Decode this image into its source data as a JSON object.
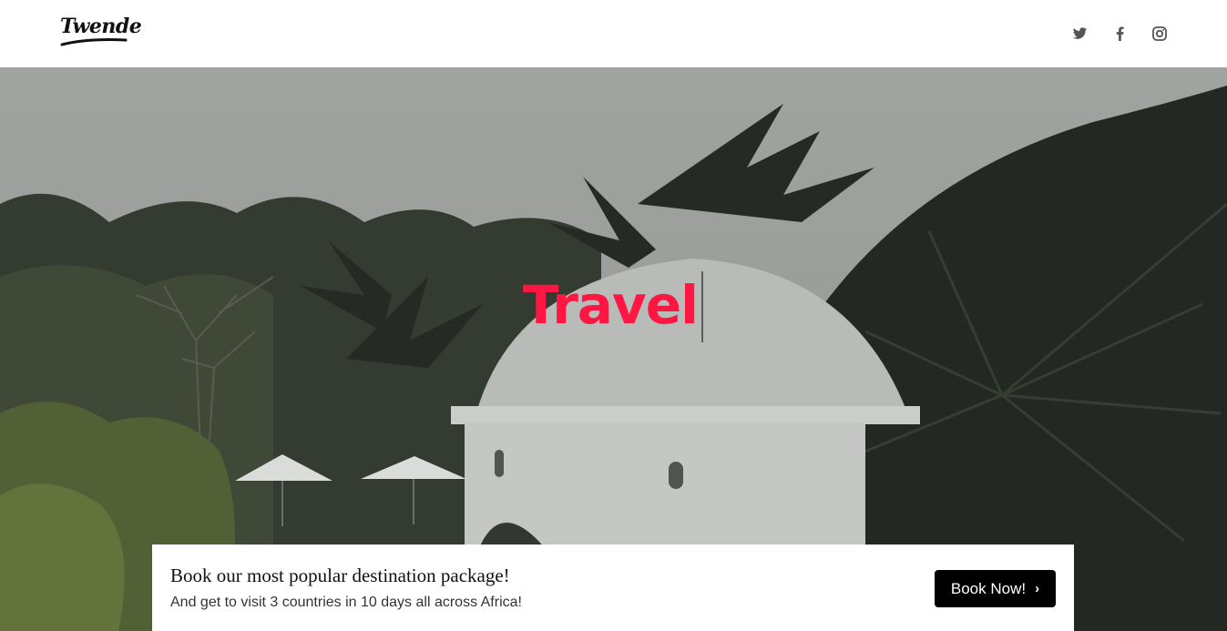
{
  "header": {
    "logo_text": "Twende",
    "social": [
      {
        "icon": "twitter-icon"
      },
      {
        "icon": "facebook-icon"
      },
      {
        "icon": "instagram-icon"
      }
    ]
  },
  "hero": {
    "headline": "Travel",
    "headline_color": "#ff1744"
  },
  "promo": {
    "title": "Book our most popular destination package!",
    "subtitle": "And get to visit 3 countries in 10 days all across Africa!",
    "button_label": "Book Now!",
    "button_icon": "chevron-right-icon"
  }
}
